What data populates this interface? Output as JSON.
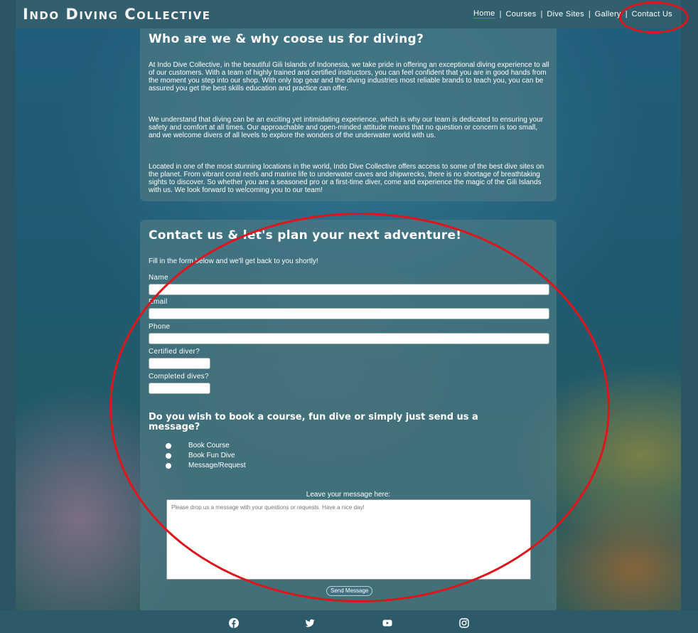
{
  "site": {
    "title": "Indo Diving Collective"
  },
  "nav": {
    "items": [
      {
        "label": "Home",
        "active": true
      },
      {
        "label": "Courses",
        "active": false
      },
      {
        "label": "Dive Sites",
        "active": false
      },
      {
        "label": "Gallery",
        "active": false
      },
      {
        "label": "Contact Us",
        "active": false
      }
    ],
    "separator": "|"
  },
  "about": {
    "title": "Who are we & why coose us for diving?",
    "paragraphs": [
      "At Indo Dive Collective, in the beautiful Gili Islands of Indonesia, we take pride in offering an exceptional diving experience to all of our customers. With a team of highly trained and certified instructors, you can feel confident that you are in good hands from the moment you step into our shop. With only top gear and the diving industries most reliable brands to teach you, you can be assured you get the best skills education and practice can offer.",
      "We understand that diving can be an exciting yet intimidating experience, which is why our team is dedicated to ensuring your safety and comfort at all times. Our approachable and open-minded attitude means that no question or concern is too small, and we welcome divers of all levels to explore the wonders of the underwater world with us.",
      "Located in one of the most stunning locations in the world, Indo Dive Collective offers access to some of the best dive sites on the planet. From vibrant coral reefs and marine life to underwater caves and shipwrecks, there is no shortage of breathtaking sights to discover. So whether you are a seasoned pro or a first-time diver, come and experience the magic of the Gili Islands with us. We look forward to welcoming you to our team!"
    ]
  },
  "contact": {
    "title": "Contact us & let's plan your next adventure!",
    "intro": "Fill in the form below and we'll get back to you shortly!",
    "fields": {
      "name": {
        "label": "Name",
        "value": ""
      },
      "email": {
        "label": "Email",
        "value": ""
      },
      "phone": {
        "label": "Phone",
        "value": ""
      },
      "certified": {
        "label": "Certified diver?",
        "value": ""
      },
      "dives": {
        "label": "Completed dives?",
        "value": ""
      }
    },
    "booking_question": "Do you wish to book a course, fun dive or simply just send us a message?",
    "options": [
      "Book Course",
      "Book Fun Dive",
      "Message/Request"
    ],
    "message_label": "Leave your message here:",
    "message_placeholder": "Please drop us a message with your questions or requests. Have a nice day!",
    "send_label": "Send Message"
  },
  "footer": {
    "icons": [
      "facebook-icon",
      "twitter-icon",
      "youtube-icon",
      "instagram-icon"
    ]
  },
  "annotations": {
    "color": "#e0141b",
    "highlights": [
      "nav-contact-us",
      "contact-form"
    ]
  }
}
